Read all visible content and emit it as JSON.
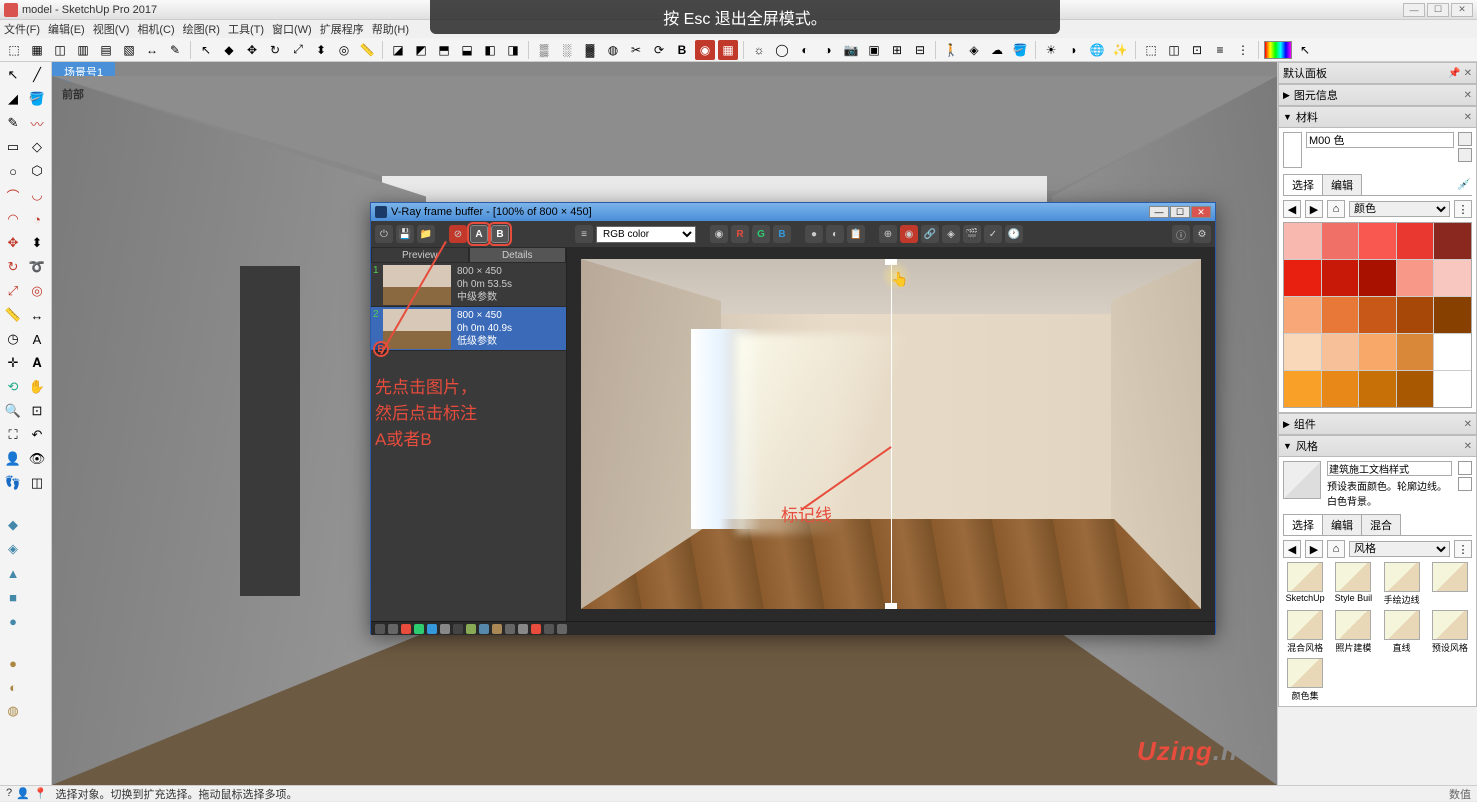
{
  "app": {
    "title": "model - SketchUp Pro 2017"
  },
  "fullscreen_notice": "按 Esc 退出全屏模式。",
  "menu": [
    "文件(F)",
    "编辑(E)",
    "视图(V)",
    "相机(C)",
    "绘图(R)",
    "工具(T)",
    "窗口(W)",
    "扩展程序",
    "帮助(H)"
  ],
  "scene_tab": "场景号1",
  "viewport_label": "前部",
  "right": {
    "tray_title": "默认面板",
    "component_info": "图元信息",
    "materials": {
      "title": "材料",
      "current_name": "M00 色",
      "tab_select": "选择",
      "tab_edit": "编辑",
      "category": "颜色"
    },
    "components_title": "组件",
    "styles": {
      "title": "风格",
      "name": "建筑施工文档样式",
      "desc": "预设表面颜色。轮廓边线。白色背景。",
      "tab_select": "选择",
      "tab_edit": "编辑",
      "tab_mix": "混合",
      "category": "风格",
      "items": [
        "SketchUp",
        "Style Buil",
        "手绘边线",
        "",
        "混合风格",
        "照片建模",
        "直线",
        "预设风格",
        "颜色集"
      ]
    }
  },
  "vfb": {
    "title": "V-Ray frame buffer - [100% of 800 × 450]",
    "channel": "RGB color",
    "tab_preview": "Preview",
    "tab_details": "Details",
    "compare_a": "A",
    "compare_b": "B",
    "rgb_r": "R",
    "rgb_g": "G",
    "rgb_b": "B",
    "history": [
      {
        "num": "1",
        "res": "800 × 450",
        "time": "0h 0m 53.5s",
        "quality": "中级参数"
      },
      {
        "num": "2",
        "res": "800 × 450",
        "time": "0h 0m 40.9s",
        "quality": "低级参数"
      }
    ]
  },
  "annotations": {
    "instruction": "先点击图片，\n然后点击标注\nA或者B",
    "marker_label": "标记线"
  },
  "statusbar": {
    "text": "选择对象。切换到扩充选择。拖动鼠标选择多项。",
    "right": "数值"
  },
  "watermark": {
    "brand": "Uzing",
    "suffix": ".net"
  },
  "swatch_colors": [
    "#f8b8b0",
    "#f07068",
    "#f85850",
    "#e83830",
    "#8a2820",
    "#e82010",
    "#c81808",
    "#a81000",
    "#f89888",
    "#f8c8c0",
    "#f8a878",
    "#e87838",
    "#c85818",
    "#a84808",
    "#884000",
    "#f8d8b8",
    "#f8c098",
    "#f8a868",
    "#d88838",
    "#fff",
    "#f8a028",
    "#e88818",
    "#c87008",
    "#a85800",
    "#fff"
  ]
}
